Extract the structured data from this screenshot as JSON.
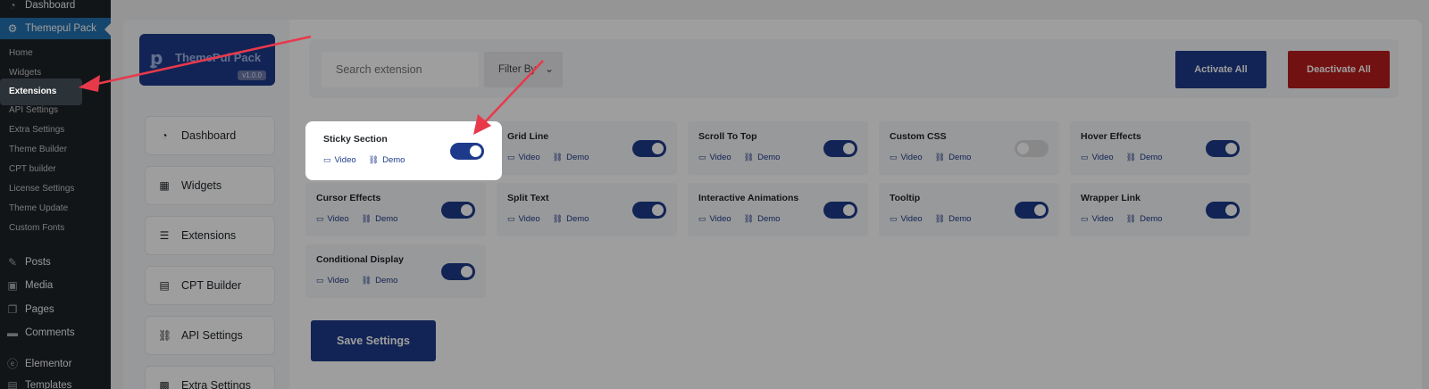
{
  "wp_menu": {
    "top_items": [
      {
        "label": "Dashboard",
        "icon": "dashboard-icon"
      },
      {
        "label": "Themepul Pack",
        "icon": "gear-icon"
      }
    ],
    "sub_items": [
      {
        "label": "Home"
      },
      {
        "label": "Widgets"
      },
      {
        "label": "Extensions"
      },
      {
        "label": "API Settings"
      },
      {
        "label": "Extra Settings"
      },
      {
        "label": "Theme Builder"
      },
      {
        "label": "CPT builder"
      },
      {
        "label": "License Settings"
      },
      {
        "label": "Theme Update"
      },
      {
        "label": "Custom Fonts"
      }
    ],
    "bottom_items": [
      {
        "label": "Posts",
        "icon": "pin-icon"
      },
      {
        "label": "Media",
        "icon": "media-icon"
      },
      {
        "label": "Pages",
        "icon": "pages-icon"
      },
      {
        "label": "Comments",
        "icon": "comment-icon"
      },
      {
        "label": "Elementor",
        "icon": "elementor-icon"
      },
      {
        "label": "Templates",
        "icon": "folder-icon"
      }
    ]
  },
  "plugin": {
    "logo_text": "ThemePul Pack",
    "version": "v1.0.0",
    "nav": [
      {
        "label": "Dashboard",
        "icon": "dashboard-icon"
      },
      {
        "label": "Widgets",
        "icon": "grid-icon"
      },
      {
        "label": "Extensions",
        "icon": "list-icon"
      },
      {
        "label": "CPT Builder",
        "icon": "table-icon"
      },
      {
        "label": "API Settings",
        "icon": "link-icon"
      },
      {
        "label": "Extra Settings",
        "icon": "settings-grid-icon"
      }
    ]
  },
  "toolbar": {
    "search_placeholder": "Search extension",
    "filter_label": "Filter By",
    "activate_all": "Activate All",
    "deactivate_all": "Deactivate All"
  },
  "extensions": [
    {
      "name": "Sticky Section",
      "enabled": true
    },
    {
      "name": "Grid Line",
      "enabled": true
    },
    {
      "name": "Scroll To Top",
      "enabled": true
    },
    {
      "name": "Custom CSS",
      "enabled": false
    },
    {
      "name": "Hover Effects",
      "enabled": true
    },
    {
      "name": "Cursor Effects",
      "enabled": true
    },
    {
      "name": "Split Text",
      "enabled": true
    },
    {
      "name": "Interactive Animations",
      "enabled": true
    },
    {
      "name": "Tooltip",
      "enabled": true
    },
    {
      "name": "Wrapper Link",
      "enabled": true
    },
    {
      "name": "Conditional Display",
      "enabled": true
    }
  ],
  "card_links": {
    "video": "Video",
    "demo": "Demo"
  },
  "save_label": "Save Settings",
  "colors": {
    "accent": "#1e3a8a",
    "danger": "#b91c1c",
    "annotation_arrow": "#e8394b",
    "wp_sidebar": "#1d2327",
    "wp_active": "#2271b1"
  }
}
